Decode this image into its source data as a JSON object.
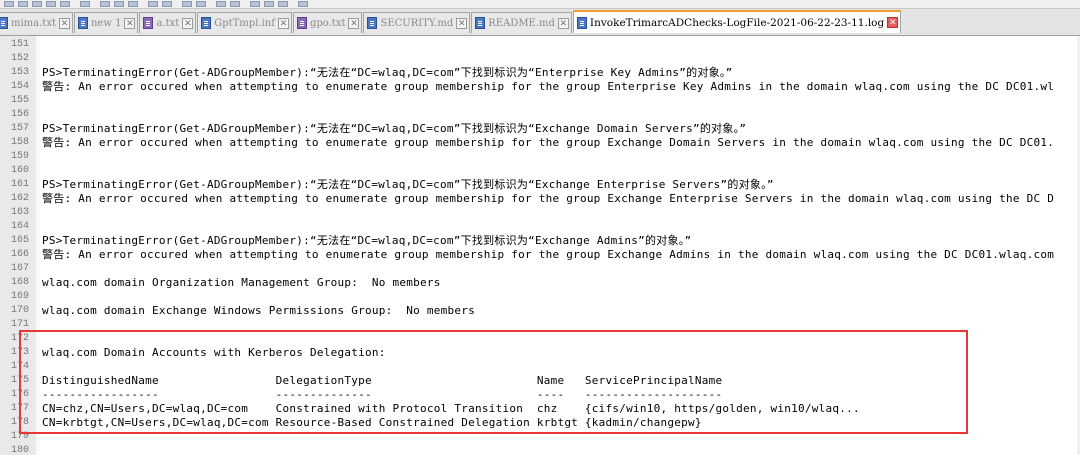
{
  "tabs": [
    {
      "label": "mima.txt",
      "icon": "blue"
    },
    {
      "label": "new 1",
      "icon": "blue"
    },
    {
      "label": "a.txt",
      "icon": "purple"
    },
    {
      "label": "GptTmpl.inf",
      "icon": "blue"
    },
    {
      "label": "gpo.txt",
      "icon": "purple"
    },
    {
      "label": "SECURITY.md",
      "icon": "blue"
    },
    {
      "label": "README.md",
      "icon": "blue"
    },
    {
      "label": "InvokeTrimarcADChecks-LogFile-2021-06-22-23-11.log",
      "icon": "blue",
      "active": true
    }
  ],
  "tab_close_glyph": "✕",
  "lines": [
    {
      "n": "151",
      "t": ""
    },
    {
      "n": "152",
      "t": ""
    },
    {
      "n": "153",
      "t": "PS>TerminatingError(Get-ADGroupMember):“无法在“DC=wlaq,DC=com”下找到标识为“Enterprise Key Admins”的对象。”"
    },
    {
      "n": "154",
      "t": "警告: An error occured when attempting to enumerate group membership for the group Enterprise Key Admins in the domain wlaq.com using the DC DC01.wl"
    },
    {
      "n": "155",
      "t": ""
    },
    {
      "n": "156",
      "t": ""
    },
    {
      "n": "157",
      "t": "PS>TerminatingError(Get-ADGroupMember):“无法在“DC=wlaq,DC=com”下找到标识为“Exchange Domain Servers”的对象。”"
    },
    {
      "n": "158",
      "t": "警告: An error occured when attempting to enumerate group membership for the group Exchange Domain Servers in the domain wlaq.com using the DC DC01."
    },
    {
      "n": "159",
      "t": ""
    },
    {
      "n": "160",
      "t": ""
    },
    {
      "n": "161",
      "t": "PS>TerminatingError(Get-ADGroupMember):“无法在“DC=wlaq,DC=com”下找到标识为“Exchange Enterprise Servers”的对象。”"
    },
    {
      "n": "162",
      "t": "警告: An error occured when attempting to enumerate group membership for the group Exchange Enterprise Servers in the domain wlaq.com using the DC D"
    },
    {
      "n": "163",
      "t": ""
    },
    {
      "n": "164",
      "t": ""
    },
    {
      "n": "165",
      "t": "PS>TerminatingError(Get-ADGroupMember):“无法在“DC=wlaq,DC=com”下找到标识为“Exchange Admins”的对象。”"
    },
    {
      "n": "166",
      "t": "警告: An error occured when attempting to enumerate group membership for the group Exchange Admins in the domain wlaq.com using the DC DC01.wlaq.com"
    },
    {
      "n": "167",
      "t": ""
    },
    {
      "n": "168",
      "t": "wlaq.com domain Organization Management Group:  No members"
    },
    {
      "n": "169",
      "t": ""
    },
    {
      "n": "170",
      "t": "wlaq.com domain Exchange Windows Permissions Group:  No members"
    },
    {
      "n": "171",
      "t": ""
    },
    {
      "n": "172",
      "t": ""
    },
    {
      "n": "173",
      "t": "wlaq.com Domain Accounts with Kerberos Delegation:"
    },
    {
      "n": "174",
      "t": ""
    },
    {
      "n": "175",
      "t": "DistinguishedName                 DelegationType                        Name   ServicePrincipalName"
    },
    {
      "n": "176",
      "t": "-----------------                 --------------                        ----   --------------------"
    },
    {
      "n": "177",
      "t": "CN=chz,CN=Users,DC=wlaq,DC=com    Constrained with Protocol Transition  chz    {cifs/win10, https/golden, win10/wlaq..."
    },
    {
      "n": "178",
      "t": "CN=krbtgt,CN=Users,DC=wlaq,DC=com Resource-Based Constrained Delegation krbtgt {kadmin/changepw}"
    },
    {
      "n": "179",
      "t": ""
    },
    {
      "n": "180",
      "t": ""
    }
  ]
}
